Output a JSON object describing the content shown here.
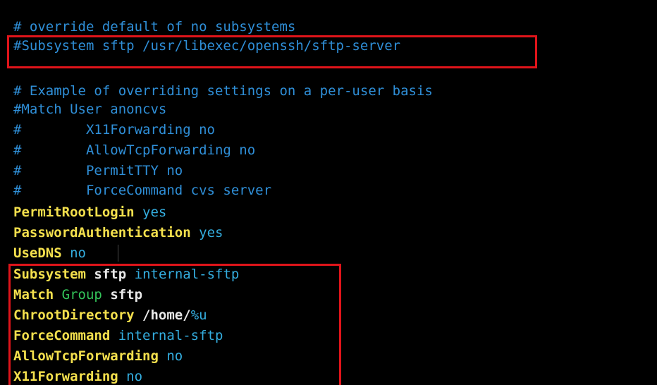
{
  "colors": {
    "background": "#000000",
    "comment": "#2f8fd8",
    "keyword": "#f4e04d",
    "value_cyan": "#34aee0",
    "value_green": "#34c45a",
    "value_white": "#e9e9e9",
    "highlight": "#e0141a"
  },
  "lines": {
    "l1": "# override default of no subsystems",
    "l2": "#Subsystem sftp /usr/libexec/openssh/sftp-server",
    "l4": "# Example of overriding settings on a per-user basis",
    "l5": "#Match User anoncvs",
    "l6": "#        X11Forwarding no",
    "l7": "#        AllowTcpForwarding no",
    "l8": "#        PermitTTY no",
    "l9": "#        ForceCommand cvs server",
    "l10_key": "PermitRootLogin",
    "l10_val": "yes",
    "l11_key": "PasswordAuthentication",
    "l11_val": "yes",
    "l12_key": "UseDNS",
    "l12_val": "no",
    "l13_key": "Subsystem",
    "l13_mid": "sftp",
    "l13_val": "internal-sftp",
    "l14_key": "Match",
    "l14_mid": "Group",
    "l14_val": "sftp",
    "l15_key": "ChrootDirectory",
    "l15_val_a": "/home/",
    "l15_val_b": "%u",
    "l16_key": "ForceCommand",
    "l16_val": "internal-sftp",
    "l17_key": "AllowTcpForwarding",
    "l17_val": "no",
    "l18_key": "X11Forwarding",
    "l18_val": "no"
  }
}
